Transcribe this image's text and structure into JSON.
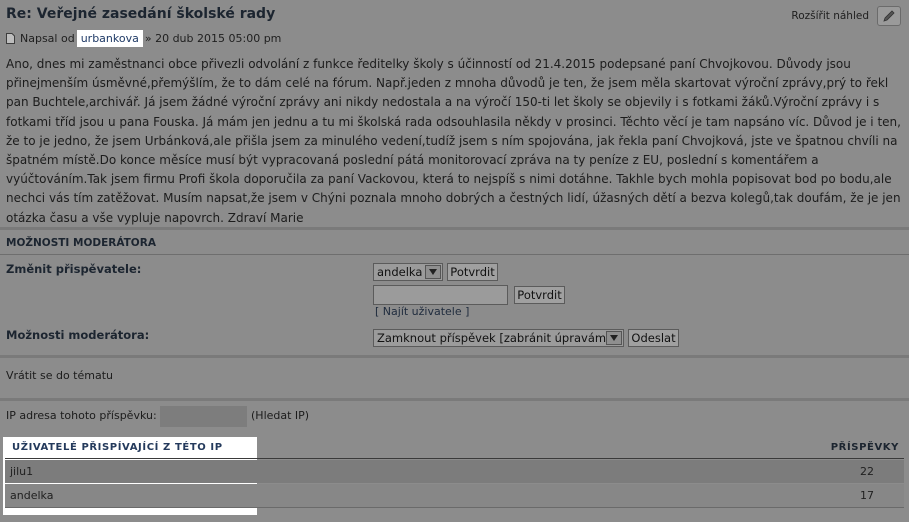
{
  "post": {
    "title": "Re: Veřejné zasedání školské rady",
    "expand_label": "Rozšířit náhled",
    "meta_prefix": "Napsal od",
    "author": "urbankova",
    "meta_suffix": "» 20 dub 2015 05:00 pm",
    "body": "Ano, dnes mi zaměstnanci obce přivezli odvolání z funkce ředitelky školy s účinností od 21.4.2015 podepsané paní Chvojkovou. Důvody jsou přinejmenším úsměvné,přemýšlím, že to dám celé na fórum. Např.jeden z mnoha důvodů je ten, že jsem měla skartovat výroční zprávy,prý to řekl pan Buchtele,archivář. Já jsem žádné výroční zprávy ani nikdy nedostala a na výročí 150-ti let školy se objevily i s fotkami žáků.Výroční zprávy i s fotkami tříd jsou u pana Fouska. Já mám jen jednu a tu mi školská rada odsouhlasila někdy v prosinci. Těchto věcí je tam napsáno víc. Důvod je i ten, že to je jedno, že jsem Urbánková,ale přišla jsem za minulého vedení,tudíž jsem s ním spojována, jak řekla paní Chvojková, jste ve špatnou chvíli na špatném místě.Do konce měsíce musí být vypracovaná poslední pátá monitorovací zpráva na ty peníze z EU, poslední s komentářem a vyúčtováním.Tak jsem firmu Profi škola doporučila za paní Vackovou, která to nejspíš s nimi dotáhne. Takhle bych mohla popisovat bod po bodu,ale nechci vás tím zatěžovat. Musím napsat,že jsem v Chýni poznala mnoho dobrých a čestných lidí, úžasných dětí a bezva kolegů,tak doufám, že je jen otázka času a vše vypluje napovrch. Zdraví Marie"
  },
  "moderator": {
    "heading": "MOŽNOSTI MODERÁTORA",
    "change_poster_label": "Změnit přispěvatele:",
    "poster_select_value": "andelka",
    "confirm_label": "Potvrdit",
    "confirm2_label": "Potvrdit",
    "find_user_label": "[ Najít uživatele ]",
    "options_label": "Možnosti moderátora:",
    "options_select_value": "Zamknout příspěvek [zabránit úpravám]",
    "send_label": "Odeslat"
  },
  "back_link": "Vrátit se do tématu",
  "ip": {
    "label": "IP adresa tohoto příspěvku:",
    "lookup_label": "(Hledat IP)"
  },
  "users_table": {
    "header_users": "UŽIVATELÉ PŘISPÍVAJÍCÍ Z TÉTO IP",
    "header_posts": "PŘÍSPĚVKY",
    "rows": [
      {
        "name": "jilu1",
        "posts": "22"
      },
      {
        "name": "andelka",
        "posts": "17"
      }
    ]
  }
}
